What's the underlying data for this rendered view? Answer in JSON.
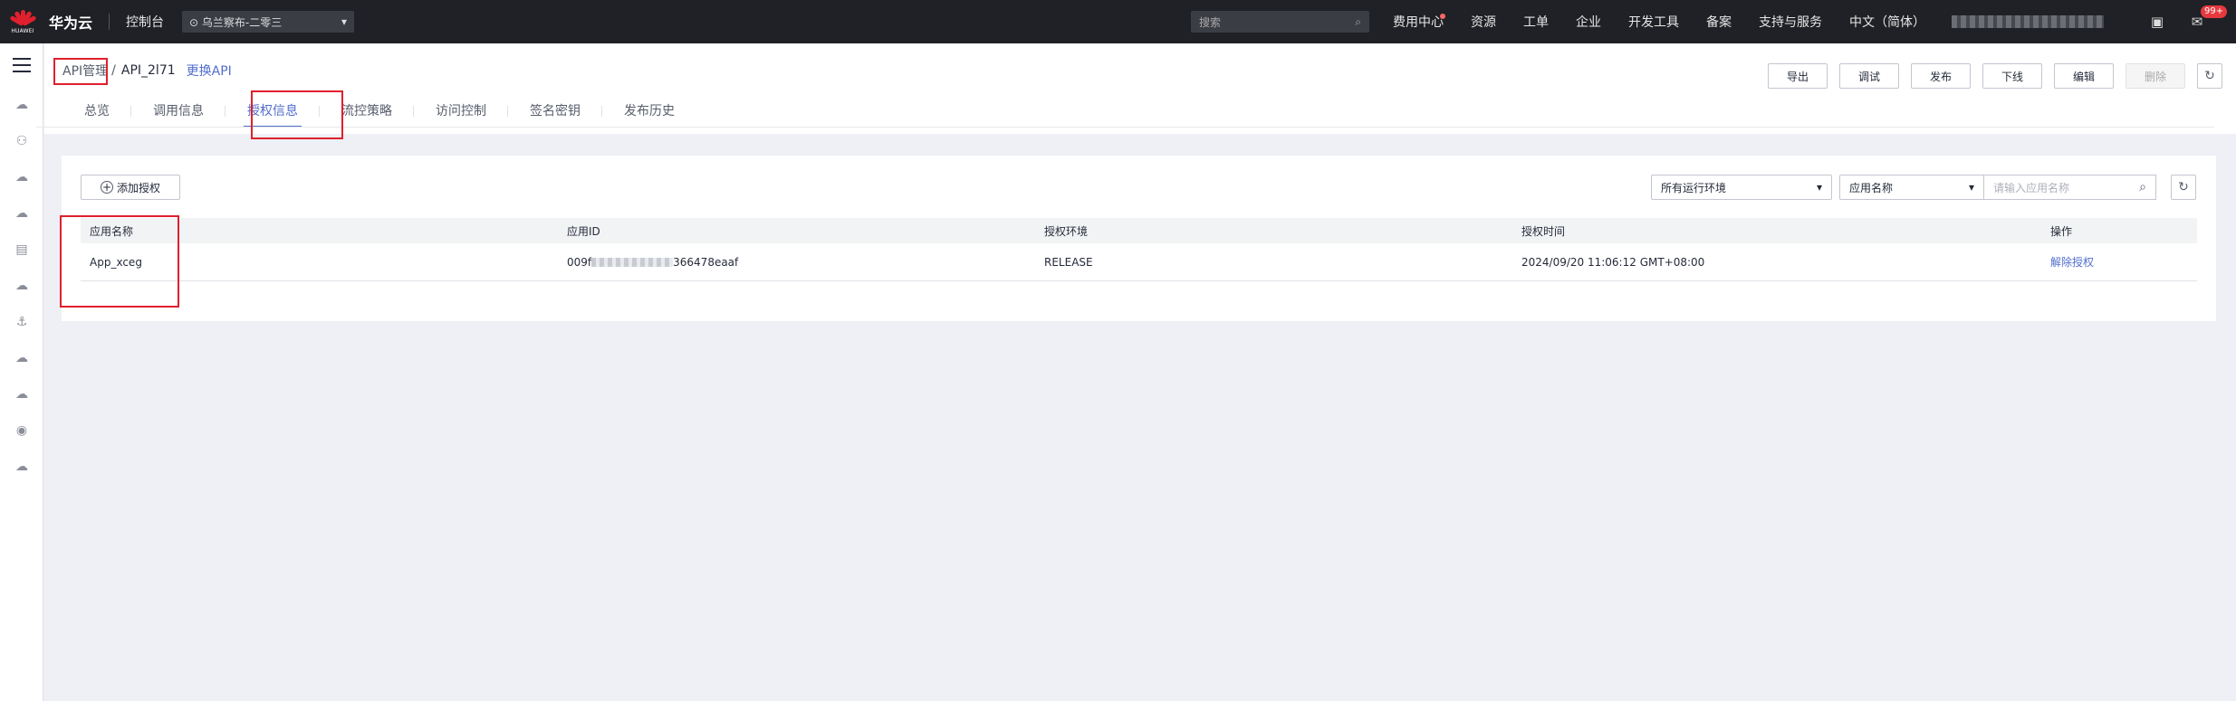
{
  "topbar": {
    "brand": "华为云",
    "logo_text": "HUAWEI",
    "console": "控制台",
    "region": "乌兰察布-二零三",
    "search_placeholder": "搜索",
    "links": [
      "费用中心",
      "资源",
      "工单",
      "企业",
      "开发工具",
      "备案",
      "支持与服务",
      "中文（简体）"
    ],
    "notification_count": "99+"
  },
  "breadcrumb": {
    "root": "API管理",
    "separator": "/",
    "current": "API_2l71",
    "change_link": "更换API"
  },
  "actions": [
    "导出",
    "调试",
    "发布",
    "下线",
    "编辑",
    "删除"
  ],
  "tabs": [
    "总览",
    "调用信息",
    "授权信息",
    "流控策略",
    "访问控制",
    "签名密钥",
    "发布历史"
  ],
  "active_tab": "授权信息",
  "toolbar": {
    "add_button": "添加授权",
    "env_select": "所有运行环境",
    "field_select": "应用名称",
    "search_placeholder": "请输入应用名称"
  },
  "table": {
    "columns": [
      "应用名称",
      "应用ID",
      "授权环境",
      "授权时间",
      "操作"
    ],
    "rows": [
      {
        "app_name": "App_xceg",
        "app_id_prefix": "009f",
        "app_id_suffix": "366478eaaf",
        "env": "RELEASE",
        "time": "2024/09/20 11:06:12 GMT+08:00",
        "action": "解除授权"
      }
    ]
  },
  "colors": {
    "accent": "#526ecc",
    "topbar": "#1f2126",
    "highlight": "#e0202e"
  }
}
